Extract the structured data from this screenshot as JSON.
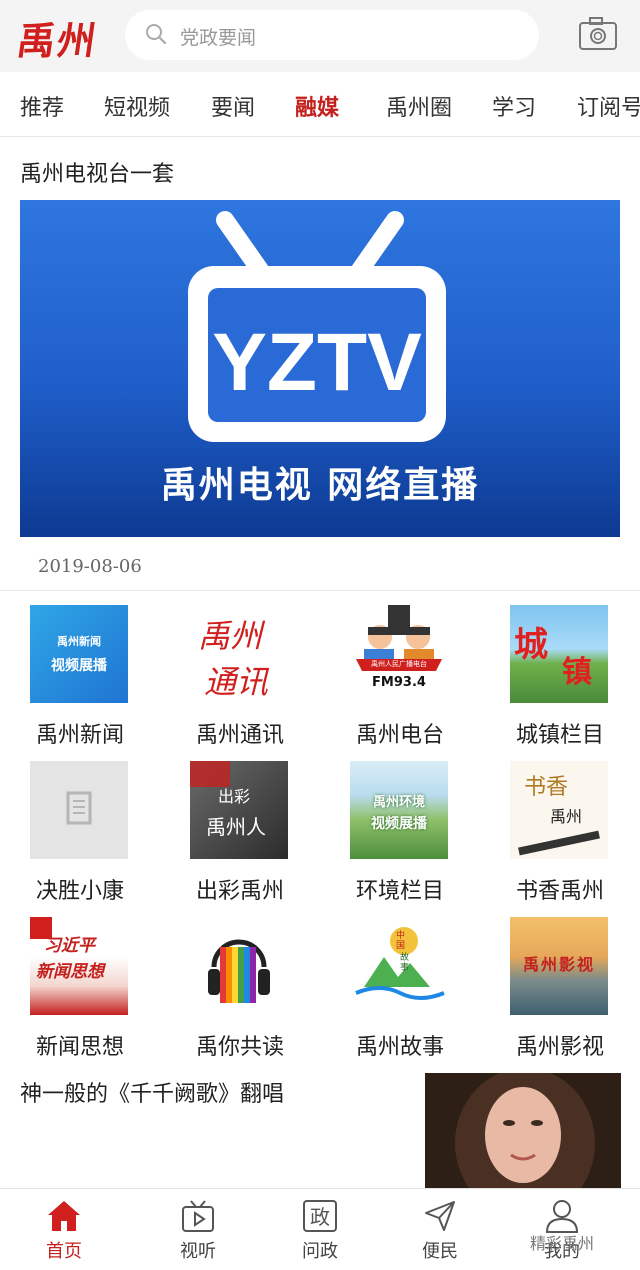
{
  "header": {
    "logo_text": "禹州",
    "search_placeholder": "党政要闻",
    "icons": [
      "search-icon",
      "camera-icon"
    ]
  },
  "tabs": [
    "推荐",
    "短视频",
    "要闻",
    "融媒",
    "禹州圈",
    "学习",
    "订阅号"
  ],
  "active_tab": "融媒",
  "section": {
    "title": "禹州电视台一套",
    "banner_logo": "YZTV",
    "banner_text": "禹州电视  网络直播",
    "date": "2019-08-06"
  },
  "grid": [
    {
      "label": "禹州新闻",
      "thumb_text": [
        "禹州新闻",
        "视频展播"
      ]
    },
    {
      "label": "禹州通讯",
      "thumb_text": [
        "禹州",
        "通讯"
      ]
    },
    {
      "label": "禹州电台",
      "thumb_text": [
        "禹州人民广播电台",
        "FM93.4"
      ]
    },
    {
      "label": "城镇栏目",
      "thumb_text": [
        "城",
        "镇"
      ]
    },
    {
      "label": "决胜小康",
      "thumb_text": []
    },
    {
      "label": "出彩禹州",
      "thumb_text": [
        "出彩",
        "禹州人"
      ]
    },
    {
      "label": "环境栏目",
      "thumb_text": [
        "禹州环境",
        "视频展播"
      ]
    },
    {
      "label": "书香禹州",
      "thumb_text": [
        "书香",
        "禹州"
      ]
    },
    {
      "label": "新闻思想",
      "thumb_text": [
        "习近平",
        "新闻思想"
      ]
    },
    {
      "label": "禹你共读",
      "thumb_text": []
    },
    {
      "label": "禹州故事",
      "thumb_text": [
        "中国",
        "故事"
      ]
    },
    {
      "label": "禹州影视",
      "thumb_text": [
        "禹州影视"
      ]
    }
  ],
  "article": {
    "title": "神一般的《千千阙歌》翻唱"
  },
  "bottom_nav": [
    {
      "label": "首页",
      "icon": "home-icon",
      "active": true
    },
    {
      "label": "视听",
      "icon": "tv-play-icon",
      "active": false
    },
    {
      "label": "问政",
      "icon": "zheng-icon",
      "active": false
    },
    {
      "label": "便民",
      "icon": "send-icon",
      "active": false
    },
    {
      "label": "我的",
      "icon": "user-icon",
      "active": false
    }
  ],
  "watermark": "精彩禹州",
  "colors": {
    "accent": "#c4201e",
    "banner_blue": "#1f5ec9"
  }
}
